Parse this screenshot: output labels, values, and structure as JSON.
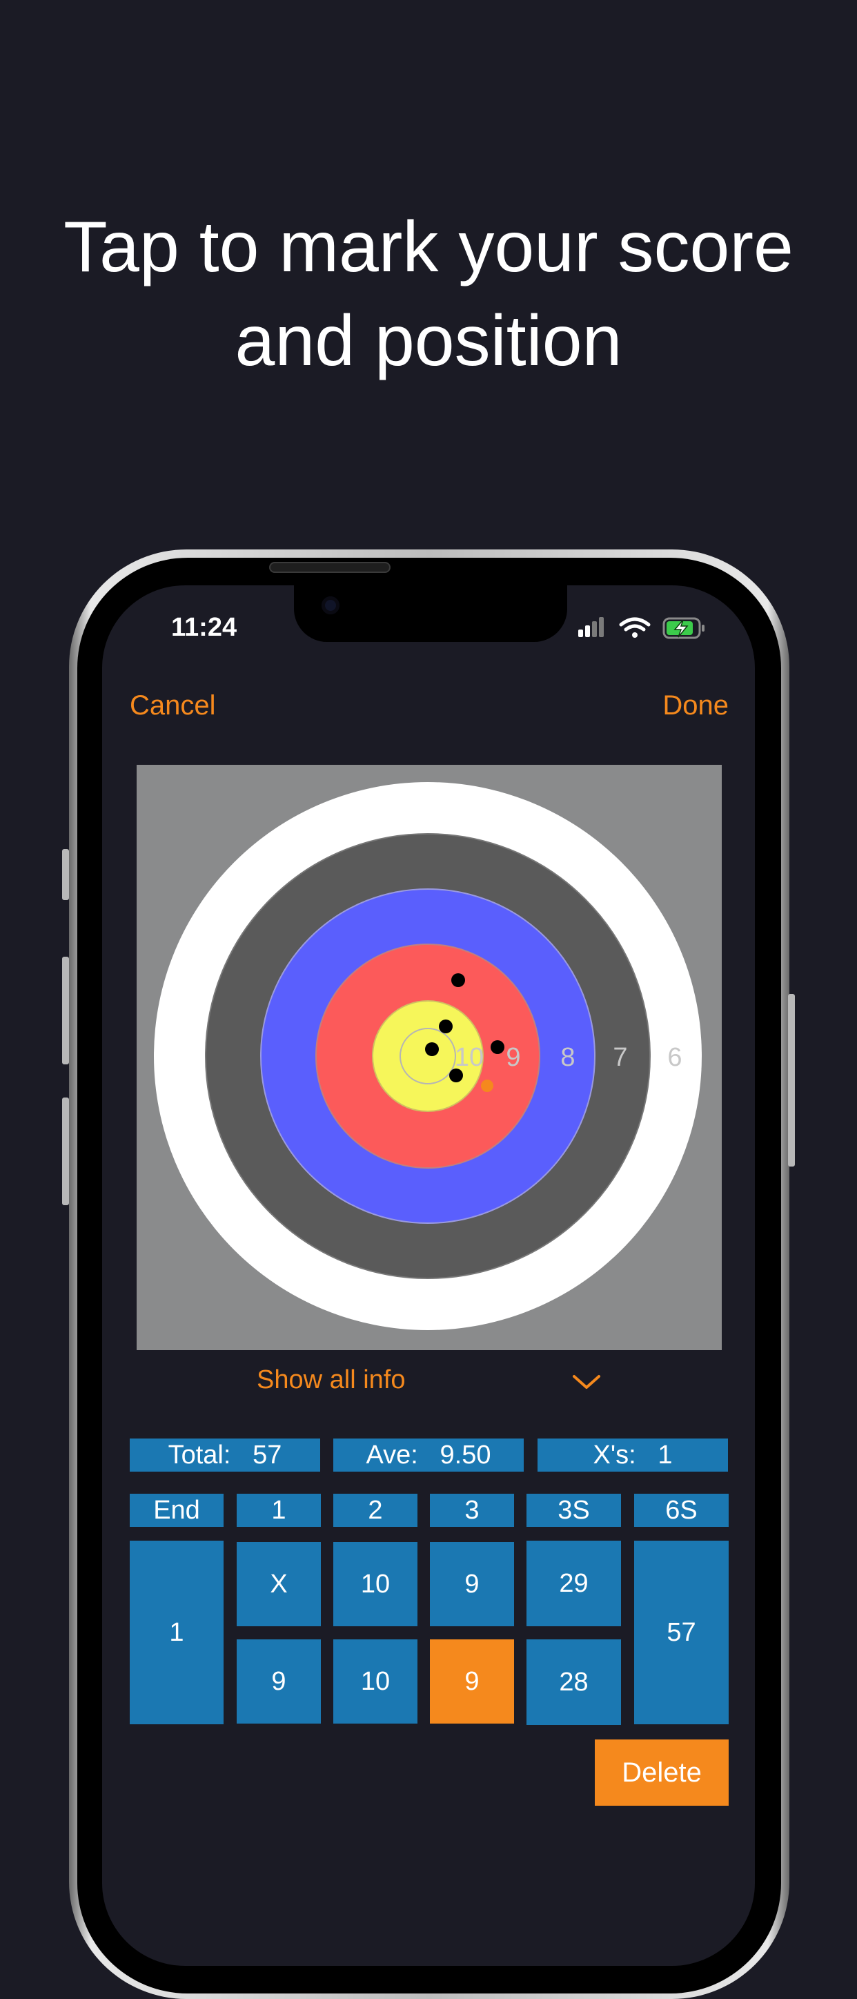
{
  "headline": {
    "line1": "Tap to mark your score",
    "line2": "and position"
  },
  "status_bar": {
    "time": "11:24",
    "icons": [
      "cellular-signal-icon",
      "wifi-icon",
      "battery-charging-icon"
    ]
  },
  "nav": {
    "cancel_label": "Cancel",
    "done_label": "Done"
  },
  "target": {
    "ring_labels": [
      "10",
      "9",
      "8",
      "7",
      "6"
    ],
    "colors": {
      "background": "#8a8b8c",
      "white": "#ffffff",
      "black": "#5a5a5a",
      "blue": "#5a5ffd",
      "red": "#fc5a5a",
      "gold": "#f6f65a",
      "arrow": "#000000",
      "selected_arrow": "#f5891d"
    }
  },
  "show_info": {
    "label": "Show all info",
    "icon": "chevron-down-icon"
  },
  "stats": {
    "total_label": "Total:",
    "total_value": "57",
    "ave_label": "Ave:",
    "ave_value": "9.50",
    "xs_label": "X's:",
    "xs_value": "1"
  },
  "scores": {
    "headers": [
      "End",
      "1",
      "2",
      "3",
      "3S",
      "6S"
    ],
    "end": "1",
    "row1": [
      "X",
      "10",
      "9",
      "29"
    ],
    "row2": [
      "9",
      "10",
      "9",
      "28"
    ],
    "total_6s": "57"
  },
  "delete_label": "Delete",
  "accent": "#f5891d",
  "cell_color": "#1b78b2"
}
